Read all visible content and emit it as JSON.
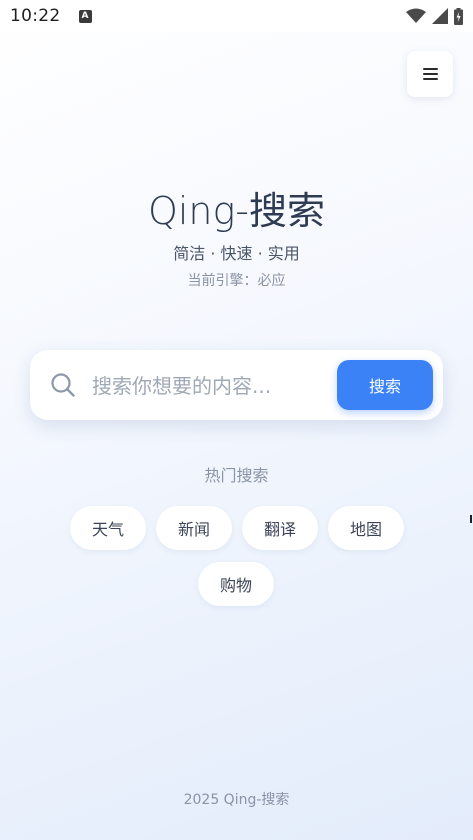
{
  "status_bar": {
    "time": "10:22",
    "app_icon_letter": "A",
    "icons": [
      "wifi-icon",
      "signal-icon",
      "battery-icon"
    ]
  },
  "menu": {
    "icon": "hamburger-menu-icon"
  },
  "hero": {
    "title": "Qing-搜索",
    "subtitle": "简洁 · 快速 · 实用",
    "engine_line": "当前引擎：必应"
  },
  "search": {
    "placeholder": "搜索你想要的内容...",
    "value": "",
    "button_label": "搜索",
    "icon": "search-icon"
  },
  "hot": {
    "title": "热门搜索",
    "items": [
      {
        "label": "天气"
      },
      {
        "label": "新闻"
      },
      {
        "label": "翻译"
      },
      {
        "label": "地图"
      },
      {
        "label": "购物"
      }
    ]
  },
  "footer": {
    "text": "2025 Qing-搜索"
  },
  "colors": {
    "accent": "#3b82f6",
    "title": "#2f3b52",
    "muted": "#8a94a6",
    "background_end": "#e3ecfb"
  }
}
